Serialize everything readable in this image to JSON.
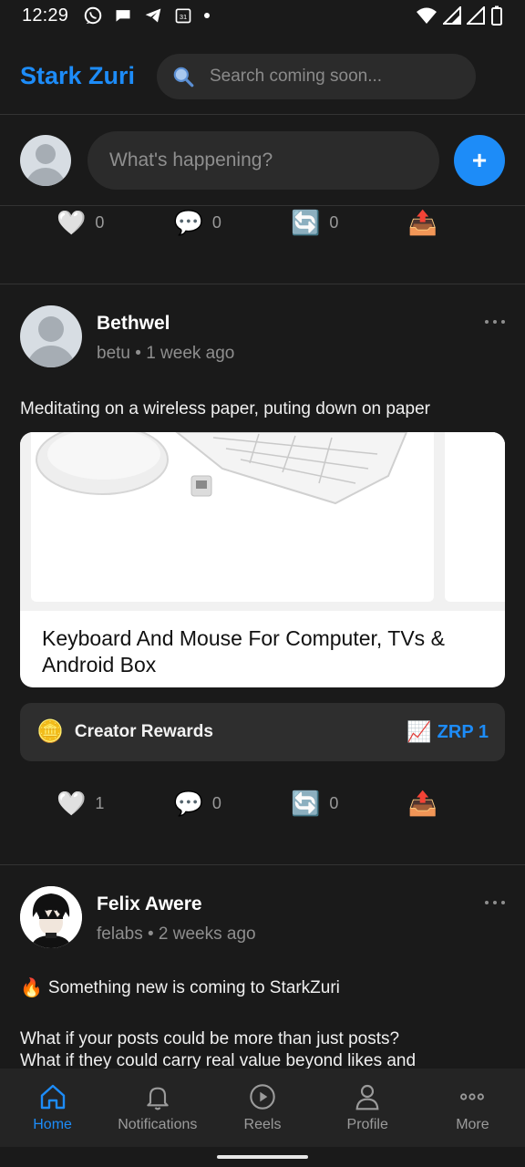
{
  "status_bar": {
    "time": "12:29"
  },
  "header": {
    "brand": "Stark Zuri",
    "search_placeholder": "Search coming soon..."
  },
  "composer": {
    "placeholder": "What's happening?",
    "add_label": "+"
  },
  "top_actions": {
    "likes": "0",
    "comments": "0",
    "reposts": "0"
  },
  "posts": [
    {
      "author": "Bethwel",
      "meta": "betu • 1 week ago",
      "text": "Meditating on a wireless paper, puting down on paper",
      "link_title": "Keyboard And Mouse For Computer, TVs & Android Box",
      "rewards_label": "Creator Rewards",
      "rewards_value": "ZRP 1",
      "likes": "1",
      "comments": "0",
      "reposts": "0"
    },
    {
      "author": "Felix Awere",
      "meta": "felabs • 2 weeks ago",
      "text_line1": "Something new is coming to StarkZuri",
      "text_line2": "What if your posts could be more than just posts?",
      "text_line3": "What if they could carry real value beyond likes and"
    }
  ],
  "nav": [
    {
      "label": "Home",
      "icon": "home-icon"
    },
    {
      "label": "Notifications",
      "icon": "bell-icon"
    },
    {
      "label": "Reels",
      "icon": "play-icon"
    },
    {
      "label": "Profile",
      "icon": "user-icon"
    },
    {
      "label": "More",
      "icon": "more-icon"
    }
  ],
  "colors": {
    "accent": "#1d8cf8",
    "background": "#1a1a1a",
    "surface": "#2b2b2b"
  }
}
